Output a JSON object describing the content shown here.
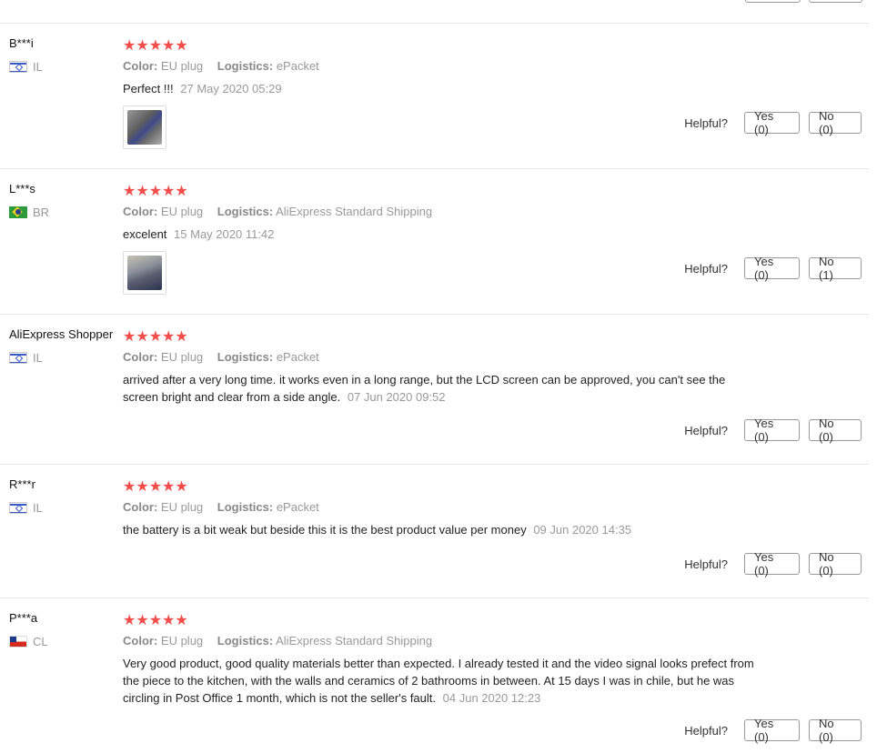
{
  "helpful_label": "Helpful?",
  "reviews": [
    {
      "user": "B***i",
      "country": "IL",
      "stars": "★★★★★",
      "color_label": "Color:",
      "color_value": "EU plug",
      "logistics_label": "Logistics:",
      "logistics_value": "ePacket",
      "text": "Perfect !!!",
      "date": "27 May 2020 05:29",
      "yes": "Yes (0)",
      "no": "No (0)"
    },
    {
      "user": "L***s",
      "country": "BR",
      "stars": "★★★★★",
      "color_label": "Color:",
      "color_value": "EU plug",
      "logistics_label": "Logistics:",
      "logistics_value": "AliExpress Standard Shipping",
      "text": "excelent",
      "date": "15 May 2020 11:42",
      "yes": "Yes (0)",
      "no": "No (1)"
    },
    {
      "user": "AliExpress Shopper",
      "country": "IL",
      "stars": "★★★★★",
      "color_label": "Color:",
      "color_value": "EU plug",
      "logistics_label": "Logistics:",
      "logistics_value": "ePacket",
      "text": "arrived after a very long time. it works even in a long range, but the LCD screen can be approved, you can't see the screen bright and clear from a side angle.",
      "date": "07 Jun 2020 09:52",
      "yes": "Yes (0)",
      "no": "No (0)"
    },
    {
      "user": "R***r",
      "country": "IL",
      "stars": "★★★★★",
      "color_label": "Color:",
      "color_value": "EU plug",
      "logistics_label": "Logistics:",
      "logistics_value": "ePacket",
      "text": "the battery is a bit weak but beside this it is the best product value per money",
      "date": "09 Jun 2020 14:35",
      "yes": "Yes (0)",
      "no": "No (0)"
    },
    {
      "user": "P***a",
      "country": "CL",
      "stars": "★★★★★",
      "color_label": "Color:",
      "color_value": "EU plug",
      "logistics_label": "Logistics:",
      "logistics_value": "AliExpress Standard Shipping",
      "text": "Very good product, good quality materials better than expected. I already tested it and the video signal looks prefect from the piece to the kitchen, with the walls and ceramics of 2 bathrooms in between. At 15 days I was in chile, but he was circling in Post Office 1 month, which is not the seller's fault.",
      "date": "04 Jun 2020 12:23",
      "yes": "Yes (0)",
      "no": "No (0)"
    }
  ]
}
